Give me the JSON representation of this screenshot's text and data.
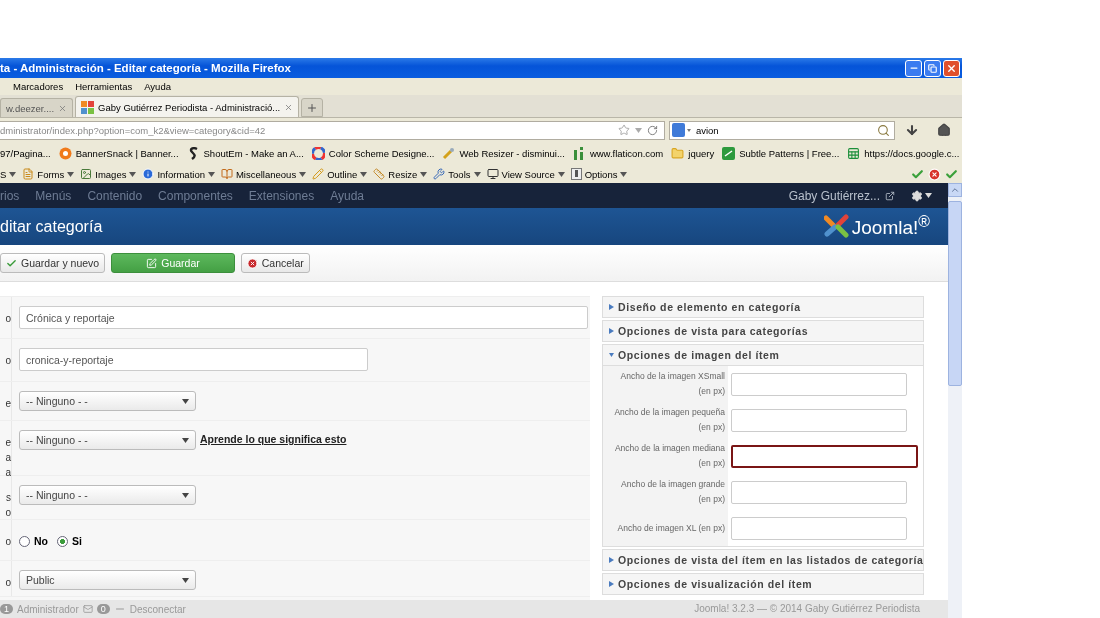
{
  "window": {
    "title": "ta - Administración - Editar categoría - Mozilla Firefox"
  },
  "menu_bar": [
    "Marcadores",
    "Herramientas",
    "Ayuda"
  ],
  "tabs": [
    {
      "label": "w.deezer....",
      "selected": false
    },
    {
      "label": "Gaby Gutiérrez Periodista - Administració...",
      "selected": true
    }
  ],
  "address_bar": {
    "value": "dministrator/index.php?option=com_k2&view=category&cid=42"
  },
  "search": {
    "value": "avion"
  },
  "bookmarks": [
    {
      "label": "97/Pagina...",
      "kind": "none"
    },
    {
      "label": "BannerSnack | Banner...",
      "kind": "circle"
    },
    {
      "label": "ShoutEm - Make an A...",
      "kind": "curve"
    },
    {
      "label": "Color Scheme Designe...",
      "kind": "wheel"
    },
    {
      "label": "Web Resizer - disminui...",
      "kind": "tool"
    },
    {
      "label": "www.flaticon.com",
      "kind": "bars"
    },
    {
      "label": "jquery",
      "kind": "folder"
    },
    {
      "label": "Subtle Patterns | Free...",
      "kind": "square"
    },
    {
      "label": "https://docs.google.c...",
      "kind": "sheet"
    }
  ],
  "dev_toolbar": [
    {
      "label": "S",
      "kind": "none"
    },
    {
      "label": "Forms",
      "kind": "form"
    },
    {
      "label": "Images",
      "kind": "image"
    },
    {
      "label": "Information",
      "kind": "info"
    },
    {
      "label": "Miscellaneous",
      "kind": "book"
    },
    {
      "label": "Outline",
      "kind": "pencil"
    },
    {
      "label": "Resize",
      "kind": "ruler"
    },
    {
      "label": "Tools",
      "kind": "tools"
    },
    {
      "label": "View Source",
      "kind": "screen"
    },
    {
      "label": "Options",
      "kind": "options"
    }
  ],
  "joomla_nav": {
    "items": [
      "rios",
      "Menús",
      "Contenido",
      "Componentes",
      "Extensiones",
      "Ayuda"
    ],
    "user": "Gaby Gutiérrez..."
  },
  "header": {
    "title": "ditar categoría",
    "logo_text": "Joomla!$^{®}$"
  },
  "toolbar": [
    {
      "label": "Guardar y nuevo",
      "kind": "check"
    },
    {
      "label": "Guardar",
      "kind": "primary"
    },
    {
      "label": "Cancelar",
      "kind": "cancel"
    }
  ],
  "form_rows": [
    {
      "label_lines": [
        "o"
      ],
      "kind": "wide-text",
      "value": "Crónica y reportaje"
    },
    {
      "label_lines": [
        "o"
      ],
      "kind": "text",
      "value": "cronica-y-reportaje"
    },
    {
      "label_lines": [
        "e"
      ],
      "kind": "select",
      "value": "-- Ninguno - -"
    },
    {
      "label_lines": [
        "e",
        "a",
        "a"
      ],
      "kind": "select",
      "value": "-- Ninguno - -",
      "link": "Aprende lo que significa esto"
    },
    {
      "label_lines": [
        "s",
        "o"
      ],
      "kind": "select",
      "value": "-- Ninguno - -"
    },
    {
      "label_lines": [
        "o"
      ],
      "kind": "radio",
      "options": [
        {
          "label": "No",
          "selected": false
        },
        {
          "label": "Si",
          "selected": true
        }
      ]
    },
    {
      "label_lines": [
        "o"
      ],
      "kind": "select",
      "value": "Public"
    }
  ],
  "panels": [
    {
      "title": "Diseño de elemento en categoría",
      "expanded": false
    },
    {
      "title": "Opciones de vista para categorías",
      "expanded": false
    },
    {
      "title": "Opciones de imagen del ítem",
      "expanded": true,
      "fields": [
        {
          "label_lines": [
            "Ancho de la imagen XSmall",
            "(en px)"
          ],
          "focused": false
        },
        {
          "label_lines": [
            "Ancho de la imagen pequeña",
            "(en px)"
          ],
          "focused": false
        },
        {
          "label_lines": [
            "Ancho de la imagen mediana",
            "(en px)"
          ],
          "focused": true
        },
        {
          "label_lines": [
            "Ancho de la imagen grande",
            "(en px)"
          ],
          "focused": false
        },
        {
          "label_lines": [
            "Ancho de imagen XL (en px)"
          ],
          "focused": false
        }
      ]
    },
    {
      "title": "Opciones de vista del ítem en las listados de categoría",
      "expanded": false
    },
    {
      "title": "Opciones de visualización del ítem",
      "expanded": false
    }
  ],
  "footer": {
    "user_count": "1",
    "user": "Administrador",
    "message_count": "0",
    "logout": "Desconectar",
    "copyright": "Joomla! 3.2.3 — © 2014 Gaby Gutiérrez Periodista"
  }
}
